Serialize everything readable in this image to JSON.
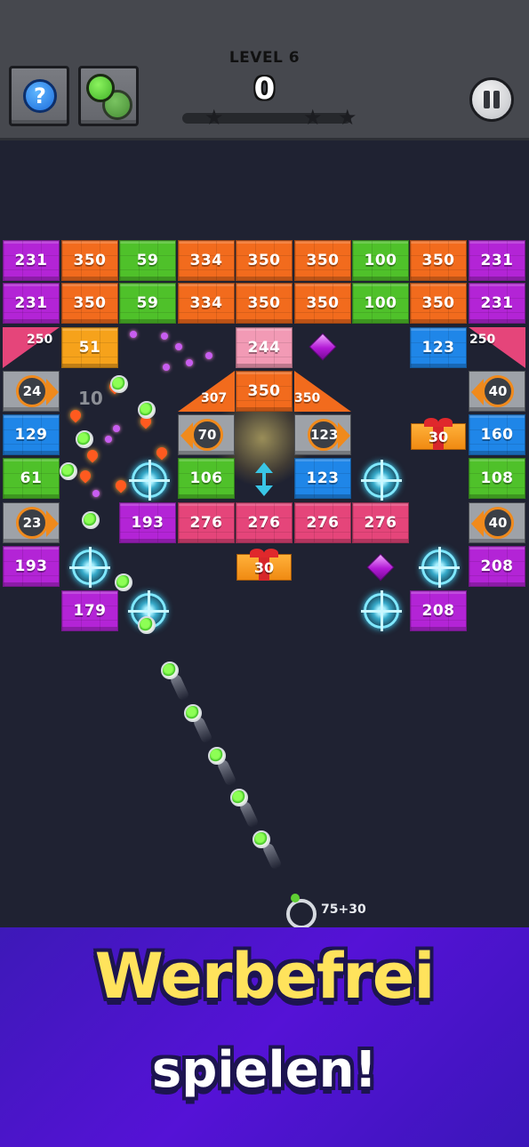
{
  "hud": {
    "level": "LEVEL 6",
    "score": "0",
    "help_glyph": "?",
    "icons": [
      "help-icon",
      "balls-icon",
      "pause-icon",
      "star-icon"
    ],
    "star_progress": 0
  },
  "board": {
    "row1": [
      "231",
      "350",
      "59",
      "334",
      "350",
      "350",
      "100",
      "350",
      "231"
    ],
    "row2": [
      "231",
      "350",
      "59",
      "334",
      "350",
      "350",
      "100",
      "350",
      "231"
    ],
    "tri_left": "250",
    "tri_right": "250",
    "brick_51": "51",
    "brick_244": "244",
    "brick_123_top": "123",
    "roof_left": "307",
    "roof_mid": "350",
    "roof_right": "350",
    "ring_left_24": "24",
    "ring_right_40_top": "40",
    "floating_10": "10",
    "brick_129": "129",
    "ring_70": "70",
    "ring_123": "123",
    "gift_top": "30",
    "brick_160": "160",
    "brick_61": "61",
    "brick_106": "106",
    "brick_123_mid": "123",
    "brick_108": "108",
    "ring_23": "23",
    "brick_193_mid": "193",
    "row_276": [
      "276",
      "276",
      "276",
      "276"
    ],
    "ring_right_40_bot": "40",
    "brick_193_left": "193",
    "gift_bottom": "30",
    "brick_208_right": "208",
    "brick_179": "179",
    "brick_208_low": "208",
    "ball_count": "75+30"
  },
  "colors": {
    "purple": "#b324d6",
    "orange": "#f26b1d",
    "green": "#4fc12a",
    "pink": "#e5457a",
    "blue": "#1f86e8",
    "light_pink": "#f29ab5",
    "amber": "#f6a21b"
  },
  "promo": {
    "title": "Werbefrei",
    "subtitle": "spielen!"
  }
}
